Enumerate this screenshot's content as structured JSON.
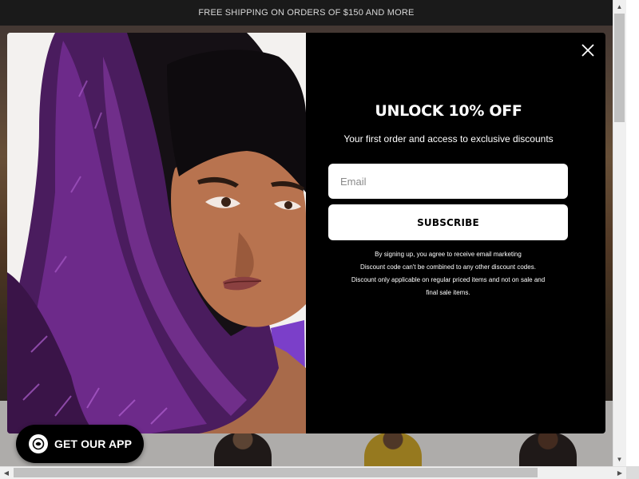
{
  "announcement": {
    "text": "FREE SHIPPING ON ORDERS OF $150 AND MORE"
  },
  "modal": {
    "title": "UNLOCK 10% OFF",
    "subtitle": "Your first order and access to exclusive discounts",
    "email_placeholder": "Email",
    "email_value": "",
    "subscribe_label": "SUBSCRIBE",
    "terms": [
      "By signing up, you agree to receive email marketing",
      "Discount code can't be combined to any other discount codes.",
      "Discount only applicable on regular priced items and not on sale and",
      "final sale items."
    ],
    "close_icon": "close-icon",
    "image_icon": "model-photo"
  },
  "app_button": {
    "label": "GET OUR APP",
    "icon": "app-logo-icon"
  },
  "scrollbars": {
    "up_icon": "▲",
    "down_icon": "▼",
    "left_icon": "◀",
    "right_icon": "▶"
  },
  "colors": {
    "modal_bg": "#000000",
    "button_bg": "#ffffff",
    "announce_bg": "#1a1a1a"
  }
}
